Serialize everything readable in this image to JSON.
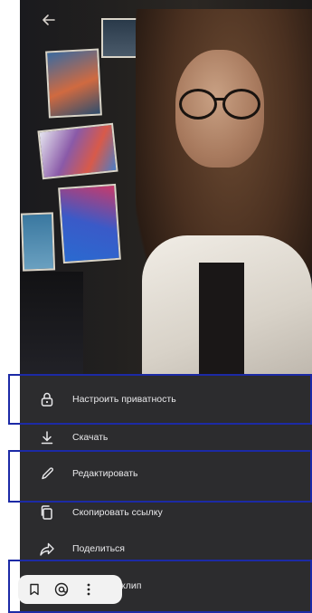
{
  "header": {
    "back_icon": "arrow-left-icon"
  },
  "menu": {
    "items": [
      {
        "label": "Настроить приватность",
        "icon": "lock-icon"
      },
      {
        "label": "Скачать",
        "icon": "download-icon"
      },
      {
        "label": "Редактировать",
        "icon": "pencil-icon"
      },
      {
        "label": "Скопировать ссылку",
        "icon": "copy-icon"
      },
      {
        "label": "Поделиться",
        "icon": "share-icon"
      },
      {
        "label": "клип",
        "icon": "clip-icon"
      }
    ]
  },
  "bottom_bar": {
    "icons": [
      "bookmark-icon",
      "mention-icon",
      "more-vertical-icon"
    ]
  },
  "colors": {
    "menu_bg": "#2c2c2e",
    "menu_text": "#e8e8ea",
    "highlight": "#1c2aa6",
    "bar_bg": "#f2f2f2"
  }
}
